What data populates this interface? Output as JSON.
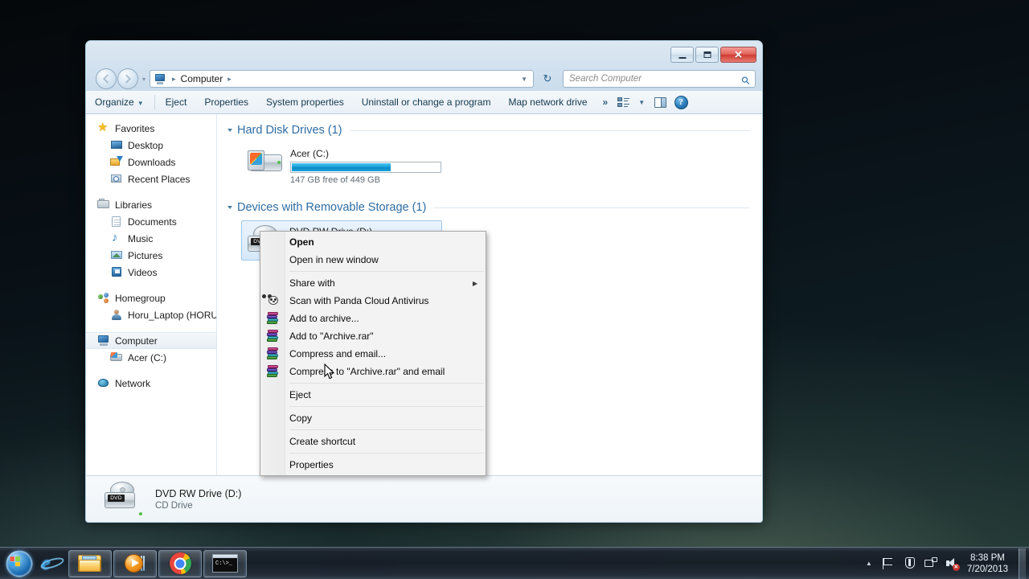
{
  "window": {
    "title": "Computer",
    "controls": {
      "minimize": "minimize-button",
      "maximize": "maximize-button",
      "close": "✕"
    }
  },
  "address": {
    "crumb_root": "Computer",
    "separator": "▸",
    "dropdown_caret": "▼",
    "refresh": "↻"
  },
  "search": {
    "placeholder": "Search Computer",
    "icon": "search-icon"
  },
  "toolbar": {
    "items": [
      {
        "label": "Organize",
        "caret": "▼"
      },
      {
        "label": "Eject",
        "caret": ""
      },
      {
        "label": "Properties",
        "caret": ""
      },
      {
        "label": "System properties",
        "caret": ""
      },
      {
        "label": "Uninstall or change a program",
        "caret": ""
      },
      {
        "label": "Map network drive",
        "caret": ""
      }
    ],
    "overflow": "»",
    "views_caret": "▼",
    "help_label": "?"
  },
  "sidebar": {
    "groups": [
      {
        "header": {
          "label": "Favorites",
          "icon": "star-icon"
        },
        "items": [
          {
            "label": "Desktop",
            "icon": "desktop-icon"
          },
          {
            "label": "Downloads",
            "icon": "downloads-icon"
          },
          {
            "label": "Recent Places",
            "icon": "recent-places-icon"
          }
        ]
      },
      {
        "header": {
          "label": "Libraries",
          "icon": "libraries-icon"
        },
        "items": [
          {
            "label": "Documents",
            "icon": "documents-icon"
          },
          {
            "label": "Music",
            "icon": "music-icon"
          },
          {
            "label": "Pictures",
            "icon": "pictures-icon"
          },
          {
            "label": "Videos",
            "icon": "videos-icon"
          }
        ]
      },
      {
        "header": {
          "label": "Homegroup",
          "icon": "homegroup-icon"
        },
        "items": [
          {
            "label": "Horu_Laptop (HORU",
            "icon": "user-icon"
          }
        ]
      },
      {
        "header": {
          "label": "Computer",
          "icon": "computer-icon",
          "selected": true
        },
        "items": [
          {
            "label": "Acer (C:)",
            "icon": "hard-drive-icon"
          }
        ]
      },
      {
        "header": {
          "label": "Network",
          "icon": "network-icon"
        },
        "items": []
      }
    ]
  },
  "content": {
    "groups": [
      {
        "title": "Hard Disk Drives (1)",
        "drives": [
          {
            "name": "Acer (C:)",
            "capacity_text": "147 GB free of 449 GB",
            "free_gb": 147,
            "total_gb": 449,
            "used_percent": 67,
            "icon": "hard-drive-icon",
            "selected": false
          }
        ]
      },
      {
        "title": "Devices with Removable Storage (1)",
        "drives": [
          {
            "name": "DVD RW Drive (D:)",
            "capacity_text": "",
            "icon": "dvd-drive-icon",
            "selected": true
          }
        ]
      }
    ]
  },
  "details_pane": {
    "title": "DVD RW Drive (D:)",
    "subtitle": "CD Drive",
    "icon": "dvd-drive-icon"
  },
  "context_menu": {
    "items": [
      {
        "label": "Open",
        "bold": true,
        "icon": "",
        "submenu": false
      },
      {
        "label": "Open in new window",
        "bold": false,
        "icon": "",
        "submenu": false
      },
      {
        "separator": true
      },
      {
        "label": "Share with",
        "bold": false,
        "icon": "",
        "submenu": true,
        "submenu_arrow": "▶"
      },
      {
        "label": "Scan with Panda Cloud Antivirus",
        "bold": false,
        "icon": "panda-icon",
        "submenu": false
      },
      {
        "label": "Add to archive...",
        "bold": false,
        "icon": "winrar-icon",
        "submenu": false
      },
      {
        "label": "Add to \"Archive.rar\"",
        "bold": false,
        "icon": "winrar-icon",
        "submenu": false
      },
      {
        "label": "Compress and email...",
        "bold": false,
        "icon": "winrar-icon",
        "submenu": false
      },
      {
        "label": "Compress to \"Archive.rar\" and email",
        "bold": false,
        "icon": "winrar-icon",
        "submenu": false
      },
      {
        "separator": true
      },
      {
        "label": "Eject",
        "bold": false,
        "icon": "",
        "submenu": false
      },
      {
        "separator": true
      },
      {
        "label": "Copy",
        "bold": false,
        "icon": "",
        "submenu": false
      },
      {
        "separator": true
      },
      {
        "label": "Create shortcut",
        "bold": false,
        "icon": "",
        "submenu": false
      },
      {
        "separator": true
      },
      {
        "label": "Properties",
        "bold": false,
        "icon": "",
        "submenu": false
      }
    ]
  },
  "taskbar": {
    "start": {
      "name": "start-orb"
    },
    "buttons": [
      {
        "name": "internet-explorer",
        "icon": "ie-icon",
        "framed": false,
        "quick": true
      },
      {
        "name": "windows-explorer",
        "icon": "folder-icon",
        "framed": true,
        "quick": false
      },
      {
        "name": "windows-media-player",
        "icon": "wmp-icon",
        "framed": true,
        "quick": false
      },
      {
        "name": "google-chrome",
        "icon": "chrome-icon",
        "framed": true,
        "quick": false
      },
      {
        "name": "command-prompt",
        "icon": "cmd-icon",
        "framed": true,
        "quick": false
      }
    ],
    "tray": {
      "expand_arrow": "▲",
      "icons": [
        "flag-icon",
        "action-center-icon",
        "network-icon",
        "volume-muted-icon"
      ],
      "clock_time": "8:38 PM",
      "clock_date": "7/20/2013"
    }
  },
  "colors": {
    "accent_blue": "#2e6da4",
    "progress_blue": "#19a3dc",
    "close_red": "#cf3c32",
    "taskbar": "#1c242e"
  }
}
